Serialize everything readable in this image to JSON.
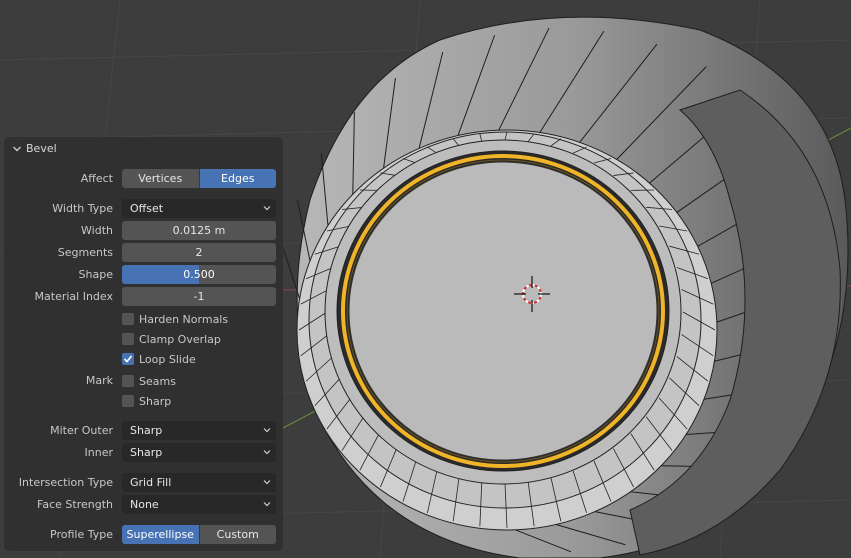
{
  "panel": {
    "title": "Bevel",
    "affect": {
      "label": "Affect",
      "options": [
        "Vertices",
        "Edges"
      ],
      "selected": "Edges"
    },
    "width_type": {
      "label": "Width Type",
      "value": "Offset"
    },
    "width": {
      "label": "Width",
      "value": "0.0125 m"
    },
    "segments": {
      "label": "Segments",
      "value": "2"
    },
    "shape": {
      "label": "Shape",
      "value": "0.500",
      "fraction": 0.5
    },
    "material_index": {
      "label": "Material Index",
      "value": "-1"
    },
    "harden_normals": {
      "label": "Harden Normals",
      "checked": false
    },
    "clamp_overlap": {
      "label": "Clamp Overlap",
      "checked": false
    },
    "loop_slide": {
      "label": "Loop Slide",
      "checked": true
    },
    "mark": {
      "label": "Mark",
      "seams": {
        "label": "Seams",
        "checked": false
      },
      "sharp": {
        "label": "Sharp",
        "checked": false
      }
    },
    "miter_outer": {
      "label": "Miter Outer",
      "value": "Sharp"
    },
    "inner": {
      "label": "Inner",
      "value": "Sharp"
    },
    "intersection_type": {
      "label": "Intersection Type",
      "value": "Grid Fill"
    },
    "face_strength": {
      "label": "Face Strength",
      "value": "None"
    },
    "profile_type": {
      "label": "Profile Type",
      "options": [
        "Superellipse",
        "Custom"
      ],
      "selected": "Superellipse"
    }
  },
  "colors": {
    "accent": "#4772b3",
    "selection": "#f0b429",
    "panel_bg": "#303030",
    "viewport_bg": "#3d3d3d"
  },
  "icons": {
    "collapse": "chevron-down-icon",
    "dropdown": "chevron-down-icon",
    "cursor": "3d-cursor-icon",
    "check": "check-icon"
  }
}
